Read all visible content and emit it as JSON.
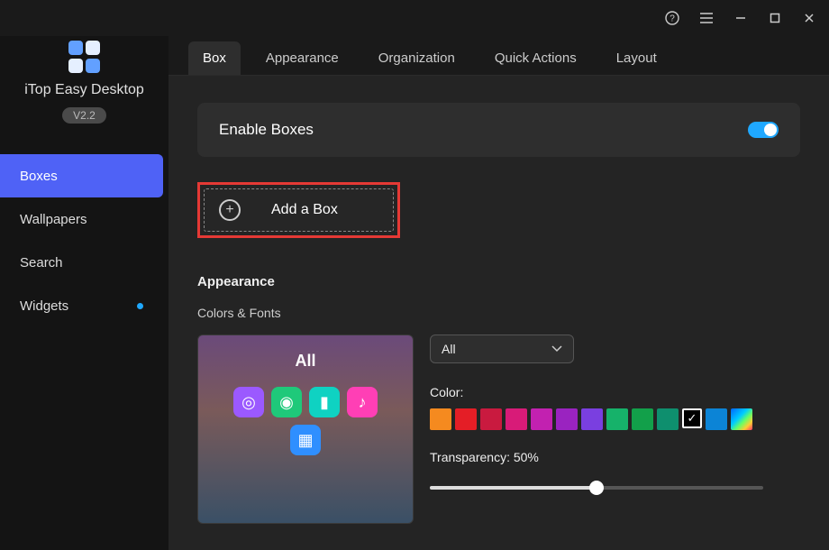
{
  "titlebar": {
    "help_icon": "help",
    "menu_icon": "menu",
    "min_icon": "minimize",
    "max_icon": "maximize",
    "close_icon": "close"
  },
  "brand": {
    "name": "iTop Easy Desktop",
    "version": "V2.2"
  },
  "sidebar": {
    "items": [
      {
        "label": "Boxes",
        "active": true,
        "dot": false
      },
      {
        "label": "Wallpapers",
        "active": false,
        "dot": false
      },
      {
        "label": "Search",
        "active": false,
        "dot": false
      },
      {
        "label": "Widgets",
        "active": false,
        "dot": true
      }
    ]
  },
  "tabs": [
    {
      "label": "Box",
      "active": true
    },
    {
      "label": "Appearance",
      "active": false
    },
    {
      "label": "Organization",
      "active": false
    },
    {
      "label": "Quick Actions",
      "active": false
    },
    {
      "label": "Layout",
      "active": false
    }
  ],
  "panel": {
    "enable_label": "Enable Boxes",
    "enable_on": true,
    "add_box_label": "Add a Box",
    "appearance_title": "Appearance",
    "colors_fonts_label": "Colors & Fonts",
    "preview_title": "All",
    "select": {
      "value": "All"
    },
    "color_label": "Color:",
    "colors": [
      {
        "hex": "#f58a1f",
        "selected": false
      },
      {
        "hex": "#e41e26",
        "selected": false
      },
      {
        "hex": "#c91a3f",
        "selected": false
      },
      {
        "hex": "#d81b78",
        "selected": false
      },
      {
        "hex": "#c221b0",
        "selected": false
      },
      {
        "hex": "#9a23c0",
        "selected": false
      },
      {
        "hex": "#7a3fe0",
        "selected": false
      },
      {
        "hex": "#16b26a",
        "selected": false
      },
      {
        "hex": "#12a04a",
        "selected": false
      },
      {
        "hex": "#0e8f6e",
        "selected": false
      },
      {
        "hex": "#000000",
        "selected": true
      },
      {
        "hex": "#0c84d6",
        "selected": false
      },
      {
        "hex": "linear-gradient(135deg,#06f,#0cf 40%,#6f6 60%,#fc3 80%,#f36)",
        "selected": false,
        "gradient": true
      }
    ],
    "transparency_label": "Transparency:",
    "transparency_value": "50%",
    "transparency_pct": 50
  }
}
